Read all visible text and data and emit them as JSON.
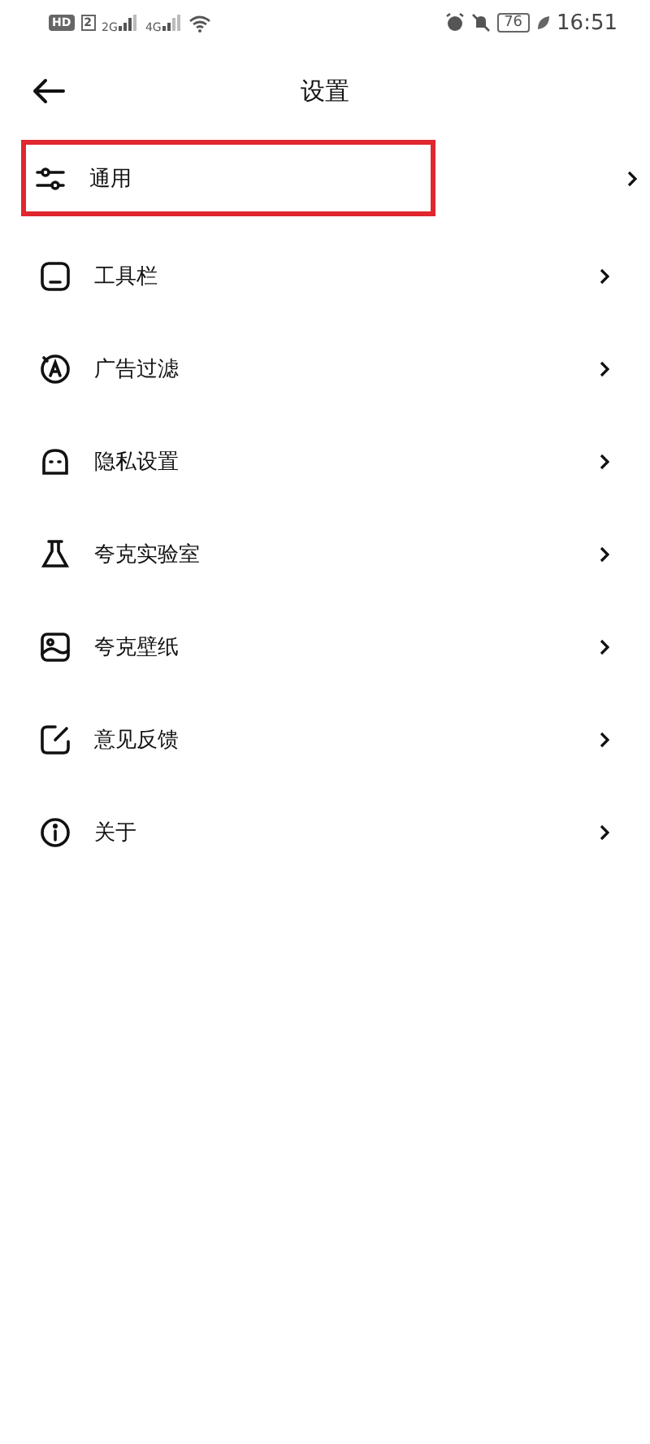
{
  "status_bar": {
    "hd": "HD",
    "sim": "2",
    "net_1": "2G",
    "net_2": "4G",
    "battery": "76",
    "time": "16:51"
  },
  "header": {
    "title": "设置"
  },
  "items": [
    {
      "label": "通用",
      "highlighted": true
    },
    {
      "label": "工具栏",
      "highlighted": false
    },
    {
      "label": "广告过滤",
      "highlighted": false
    },
    {
      "label": "隐私设置",
      "highlighted": false
    },
    {
      "label": "夸克实验室",
      "highlighted": false
    },
    {
      "label": "夸克壁纸",
      "highlighted": false
    },
    {
      "label": "意见反馈",
      "highlighted": false
    },
    {
      "label": "关于",
      "highlighted": false
    }
  ]
}
